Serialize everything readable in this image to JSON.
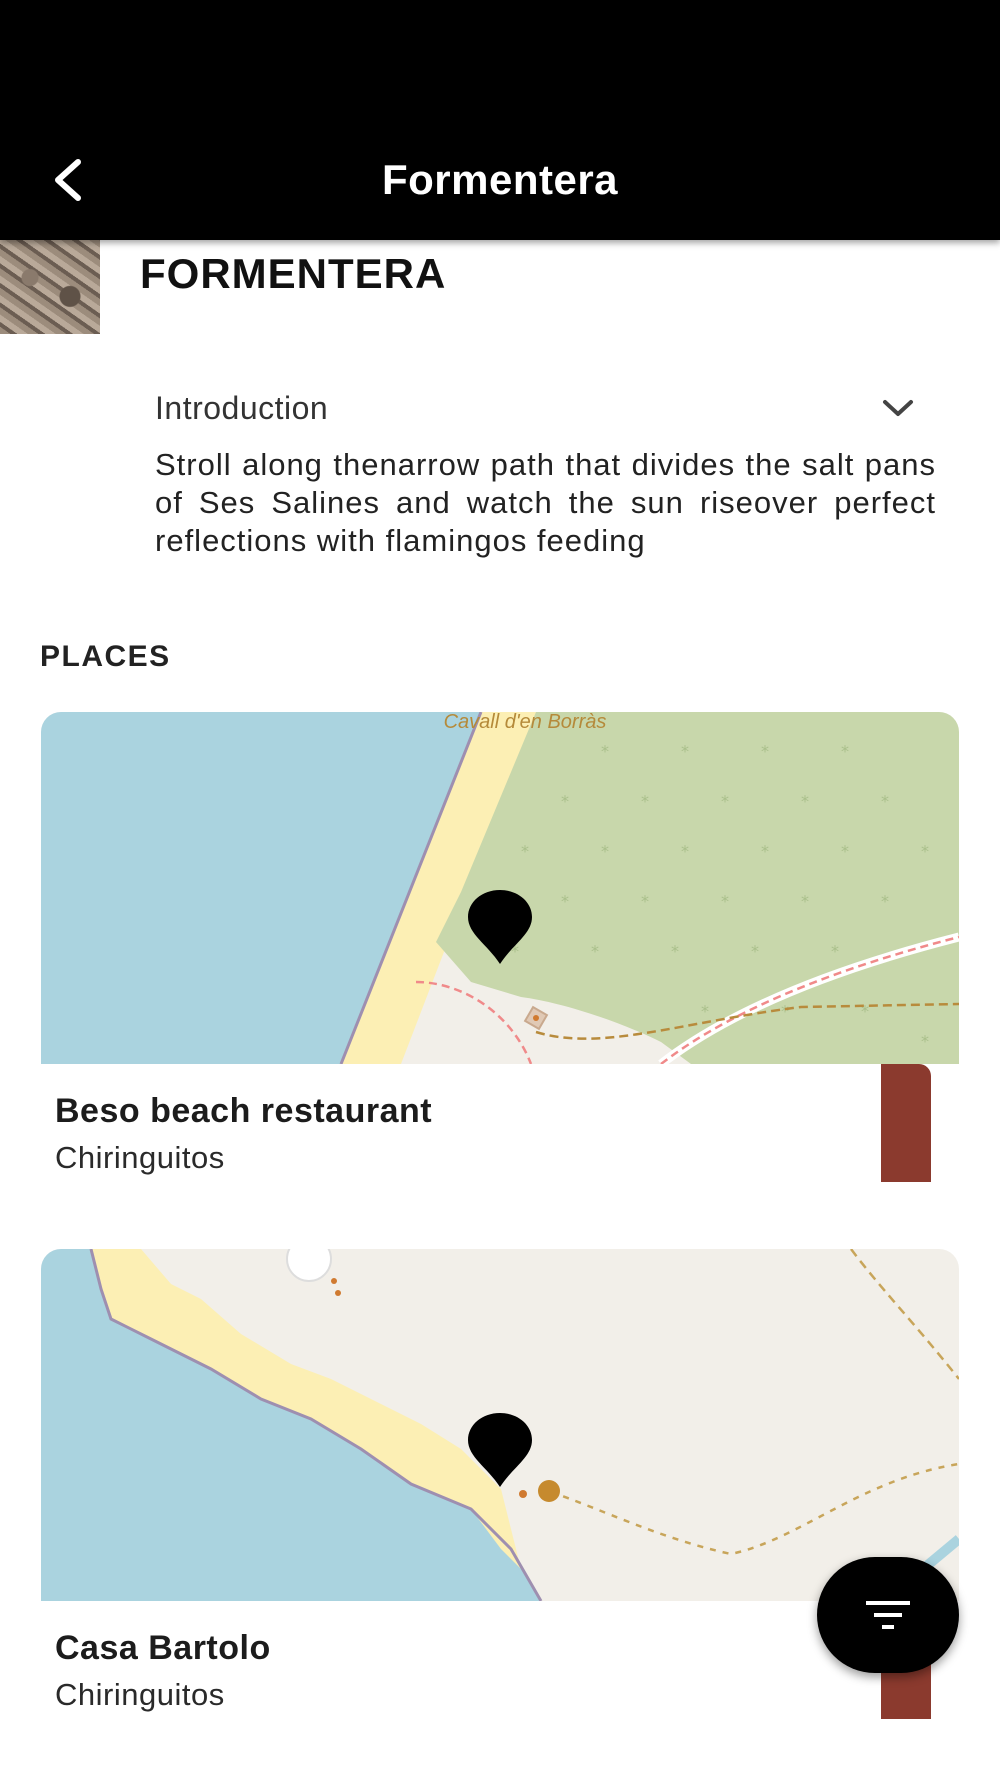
{
  "app_bar": {
    "title": "Formentera",
    "back_icon": "chevron-left-icon"
  },
  "header": {
    "heading": "FORMENTERA"
  },
  "introduction": {
    "label": "Introduction",
    "toggle_icon": "chevron-down-icon",
    "text": "Stroll along thenarrow path that divides the salt pans of Ses Salines and watch the sun riseover perfect reflections with flamingos feeding"
  },
  "places": {
    "section_label": "PLACES",
    "items": [
      {
        "title": "Beso beach restaurant",
        "category": "Chiringuitos",
        "map_label": "Cavall d'en Borràs",
        "tag_color": "#8b3a2e"
      },
      {
        "title": "Casa Bartolo",
        "category": "Chiringuitos",
        "tag_color": "#8b3a2e"
      }
    ]
  },
  "fab": {
    "icon": "filter-icon"
  },
  "colors": {
    "bar_background": "#000000",
    "sea": "#aad3df",
    "forest": "#c8d7ab",
    "sand": "#fcefb4",
    "land": "#f2efe9",
    "accent": "#8b3a2e"
  }
}
